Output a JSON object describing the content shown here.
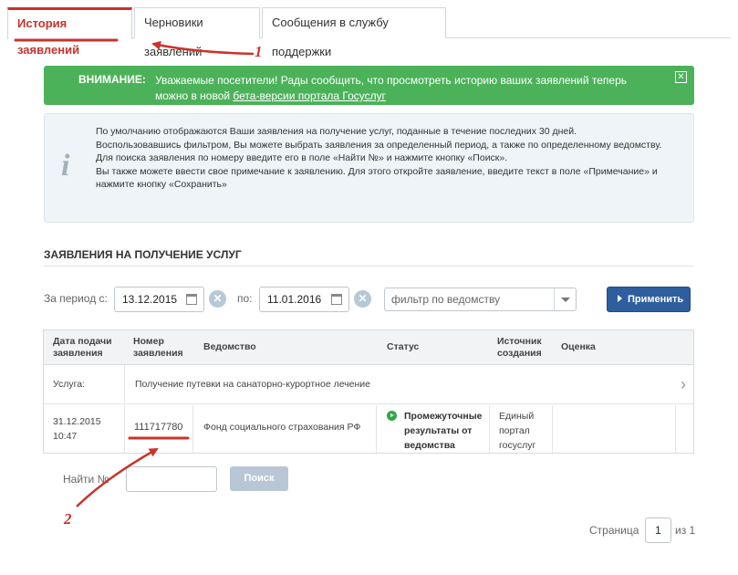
{
  "tabs": [
    {
      "label": "История заявлений",
      "active": true
    },
    {
      "label": "Черновики заявлений",
      "active": false
    },
    {
      "label": "Сообщения в службу поддержки",
      "active": false
    }
  ],
  "alert": {
    "title": "ВНИМАНИЕ:",
    "text": "Уважаемые посетители! Рады сообщить, что просмотреть историю ваших заявлений теперь можно в новой ",
    "link": "бета-версии портала Госуслуг",
    "close_glyph": "✕",
    "color": "#4cb25a"
  },
  "info": {
    "icon": "i",
    "lines": [
      "По умолчанию отображаются Ваши заявления на получение услуг, поданные в течение последних 30 дней.",
      "Воспользовавшись фильтром, Вы можете выбрать заявления за определенный период, а также по определенному ведомству.",
      "Для поиска заявления по номеру введите его в поле «Найти №» и  нажмите кнопку «Поиск».",
      "Вы также можете ввести свое примечание к заявлению. Для этого откройте заявление, введите текст в поле «Примечание» и нажмите кнопку «Сохранить»"
    ]
  },
  "section": {
    "title": "ЗАЯВЛЕНИЯ НА ПОЛУЧЕНИЕ УСЛУГ"
  },
  "filter": {
    "period_label": "За период с:",
    "date_from": "13.12.2015",
    "to_label": "по:",
    "date_to": "11.01.2016",
    "agency_placeholder": "фильтр по ведомству",
    "apply_label": "Применить"
  },
  "table": {
    "headers": {
      "date": [
        "Дата подачи",
        "заявления"
      ],
      "number": [
        "Номер",
        "заявления"
      ],
      "agency": "Ведомство",
      "status": "Статус",
      "source": [
        "Источник",
        "создания"
      ],
      "rating": "Оценка"
    },
    "service": {
      "label": "Услуга:",
      "name": "Получение путевки на санаторно-курортное лечение"
    },
    "row": {
      "date": "31.12.2015",
      "time": "10:47",
      "number": "111717780",
      "agency": "Фонд социального страхования РФ",
      "status": [
        "Промежуточные",
        "результаты от",
        "ведомства"
      ],
      "source": [
        "Единый",
        "портал",
        "госуслуг"
      ]
    }
  },
  "search": {
    "label": "Найти №",
    "button": "Поиск"
  },
  "pagination": {
    "label": "Страница",
    "page": "1",
    "of": "из 1"
  },
  "annotations": {
    "one": "1",
    "two": "2",
    "color": "#c8332c"
  }
}
